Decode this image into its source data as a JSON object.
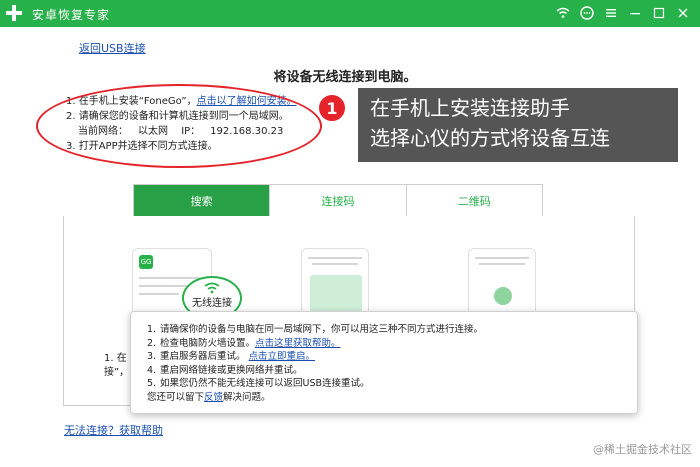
{
  "window": {
    "title": "安卓恢复专家",
    "icons": [
      "wifi-icon",
      "chat-icon",
      "menu-icon",
      "minimize-icon",
      "maximize-icon",
      "close-icon"
    ]
  },
  "back_link": "返回USB连接",
  "heading": "将设备无线连接到电脑。",
  "instructions": {
    "step1_prefix": "1. 在手机上安装“FoneGo”，",
    "step1_link": "点击以了解如何安装。",
    "step2": "2. 请确保您的设备和计算机连接到同一个局域网。",
    "network_label": "当前网络：",
    "network_value": "以太网",
    "ip_label": "IP：",
    "ip_value": "192.168.30.23",
    "step3": "3. 打开APP并选择不同方式连接。"
  },
  "callout": {
    "number": "1",
    "line1": "在手机上安装连接助手",
    "line2": "选择心仪的方式将设备互连"
  },
  "tabs": [
    {
      "label": "搜索",
      "active": true
    },
    {
      "label": "连接码",
      "active": false
    },
    {
      "label": "二维码",
      "active": false
    }
  ],
  "cards": {
    "card1_logo": "GG",
    "badge_label": "无线连接"
  },
  "panel_fragment": {
    "line1": "1. 在",
    "line2": "接”，"
  },
  "help_popup": {
    "item1": "请确保你的设备与电脑在同一局域网下，你可以用这三种不同方式进行连接。",
    "item2_prefix": "检查电脑防火墙设置。",
    "item2_link": "点击这里获取帮助。",
    "item3_prefix": "重启服务器后重试。",
    "item3_link": "点击立即重启。",
    "item4": "重启网络链接或更换网络并重试。",
    "item5": "如果您仍然不能无线连接可以返回USB连接重试。",
    "footer_prefix": "您还可以留下",
    "footer_link": "反馈",
    "footer_suffix": "解决问题。"
  },
  "bottom_link": "无法连接？获取帮助",
  "watermark": "@稀土掘金技术社区",
  "colors": {
    "brand_green": "#27b14a",
    "active_tab": "#27a046",
    "link_blue": "#1a4fb0",
    "annotation_red": "#e4232a",
    "callout_bg": "#555555"
  }
}
